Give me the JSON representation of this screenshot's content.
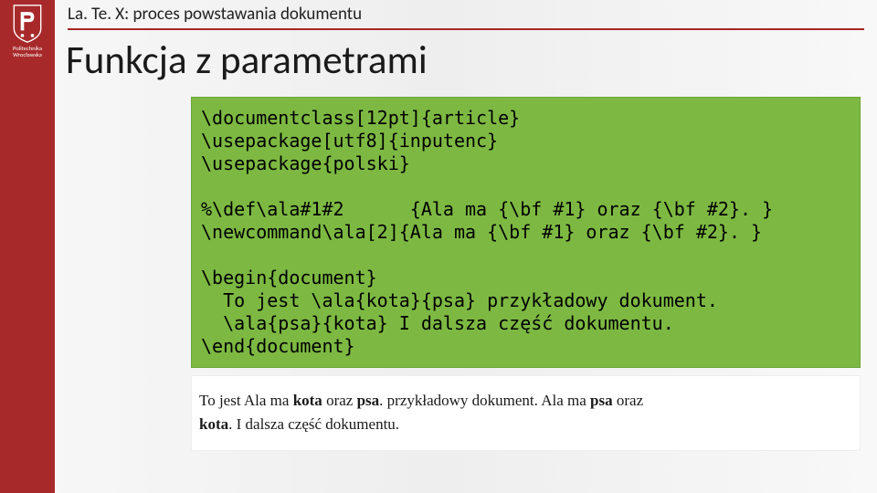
{
  "sidebar": {
    "logo_label_line1": "Politechnika",
    "logo_label_line2": "Wrocławska"
  },
  "header": "La. Te. X: proces powstawania dokumentu",
  "title": "Funkcja z parametrami",
  "code": {
    "line1": "\\documentclass[12pt]{article}",
    "line2": "\\usepackage[utf8]{inputenc}",
    "line3": "\\usepackage{polski}",
    "blank1": "",
    "line4": "%\\def\\ala#1#2      {Ala ma {\\bf #1} oraz {\\bf #2}. }",
    "line5": "\\newcommand\\ala[2]{Ala ma {\\bf #1} oraz {\\bf #2}. }",
    "blank2": "",
    "line6": "\\begin{document}",
    "line7": "  To jest \\ala{kota}{psa} przykładowy dokument.",
    "line8": "  \\ala{psa}{kota} I dalsza część dokumentu.",
    "line9": "\\end{document}"
  },
  "output": {
    "t1": "To jest Ala ma ",
    "b1": "kota",
    "t2": " oraz ",
    "b2": "psa",
    "t3": ". przykładowy dokument. Ala ma ",
    "b3": "psa",
    "t4": " oraz ",
    "b4": "kota",
    "t5": ". I dalsza część dokumentu."
  }
}
